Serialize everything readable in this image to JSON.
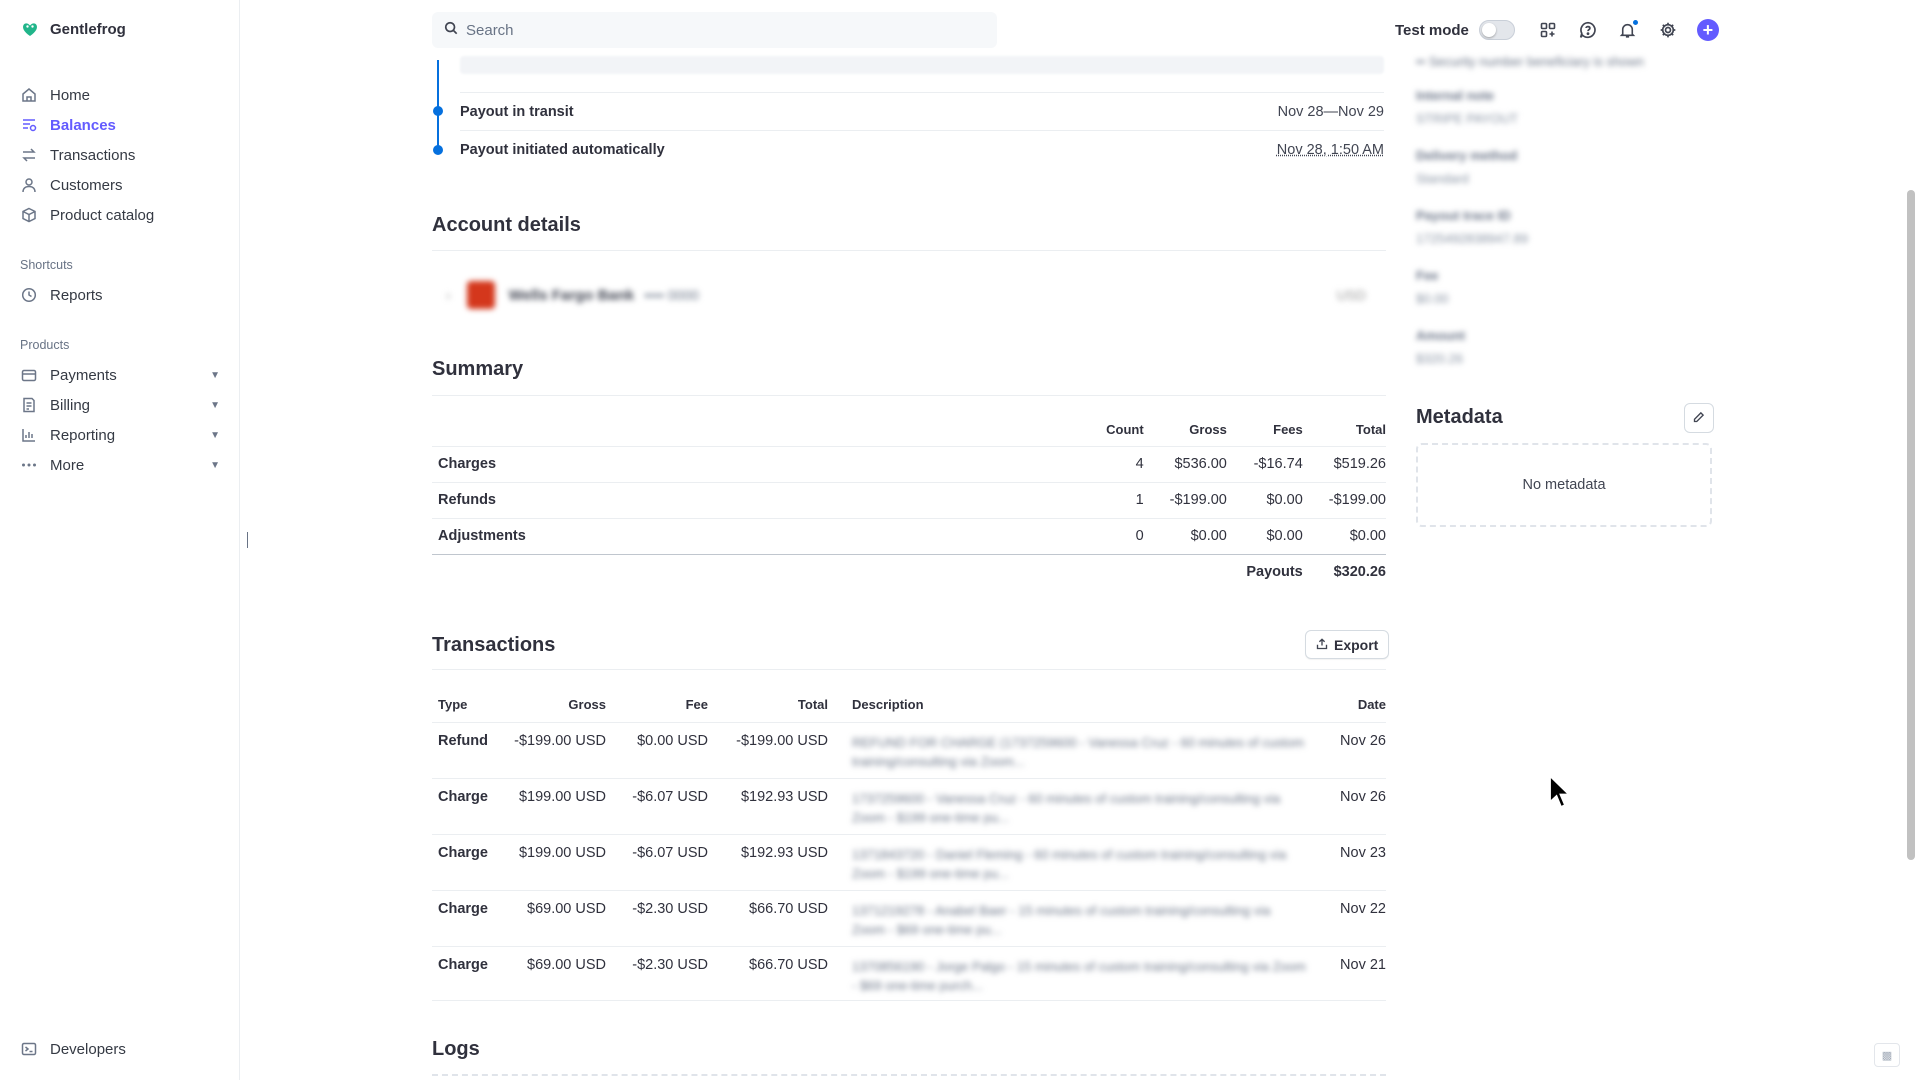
{
  "brand": {
    "name": "Gentlefrog",
    "icon": "gentlefrog-logo-icon",
    "accent": "#635bff"
  },
  "sidebar": {
    "items": [
      {
        "label": "Home",
        "icon": "home-icon"
      },
      {
        "label": "Balances",
        "icon": "balances-icon",
        "active": true
      },
      {
        "label": "Transactions",
        "icon": "transactions-icon"
      },
      {
        "label": "Customers",
        "icon": "customers-icon"
      },
      {
        "label": "Product catalog",
        "icon": "product-catalog-icon"
      }
    ],
    "shortcuts_label": "Shortcuts",
    "shortcuts": [
      {
        "label": "Reports",
        "icon": "clock-icon"
      }
    ],
    "products_label": "Products",
    "products": [
      {
        "label": "Payments",
        "icon": "payments-icon"
      },
      {
        "label": "Billing",
        "icon": "billing-icon"
      },
      {
        "label": "Reporting",
        "icon": "reporting-icon"
      },
      {
        "label": "More",
        "icon": "more-icon"
      }
    ],
    "developers": {
      "label": "Developers",
      "icon": "terminal-icon"
    }
  },
  "topbar": {
    "search_placeholder": "Search",
    "test_mode_label": "Test mode",
    "test_mode_on": false
  },
  "timeline": [
    {
      "label": "Payout in transit",
      "date": "Nov 28—Nov 29"
    },
    {
      "label": "Payout initiated automatically",
      "date": "Nov 28, 1:50 AM"
    }
  ],
  "account_details": {
    "title": "Account details",
    "bank_name": "Wells Fargo Bank",
    "last4": "•••• 0000",
    "currency": "USD"
  },
  "summary": {
    "title": "Summary",
    "headers": [
      "Count",
      "Gross",
      "Fees",
      "Total"
    ],
    "rows": [
      {
        "name": "Charges",
        "count": "4",
        "gross": "$536.00",
        "fees": "-$16.74",
        "total": "$519.26"
      },
      {
        "name": "Refunds",
        "count": "1",
        "gross": "-$199.00",
        "fees": "$0.00",
        "total": "-$199.00"
      },
      {
        "name": "Adjustments",
        "count": "0",
        "gross": "$0.00",
        "fees": "$0.00",
        "total": "$0.00"
      }
    ],
    "payouts_label": "Payouts",
    "payouts_total": "$320.26"
  },
  "transactions": {
    "title": "Transactions",
    "export_label": "Export",
    "headers": {
      "type": "Type",
      "gross": "Gross",
      "fee": "Fee",
      "total": "Total",
      "description": "Description",
      "date": "Date"
    },
    "rows": [
      {
        "type": "Refund",
        "gross": "-$199.00 USD",
        "fee": "$0.00 USD",
        "total": "-$199.00 USD",
        "description": "REFUND FOR CHARGE (1737259600 - Vanessa Cruz - 60 minutes of custom training/consulting via Zoom...",
        "date": "Nov 26"
      },
      {
        "type": "Charge",
        "gross": "$199.00 USD",
        "fee": "-$6.07 USD",
        "total": "$192.93 USD",
        "description": "1737259600 - Vanessa Cruz - 60 minutes of custom training/consulting via Zoom - $199 one-time pu...",
        "date": "Nov 26"
      },
      {
        "type": "Charge",
        "gross": "$199.00 USD",
        "fee": "-$6.07 USD",
        "total": "$192.93 USD",
        "description": "1371843720 - Daniel Fleming - 60 minutes of custom training/consulting via Zoom - $199 one-time pu...",
        "date": "Nov 23"
      },
      {
        "type": "Charge",
        "gross": "$69.00 USD",
        "fee": "-$2.30 USD",
        "total": "$66.70 USD",
        "description": "1371219278 - Anabel Baer - 15 minutes of custom training/consulting via Zoom - $69 one-time pu...",
        "date": "Nov 22"
      },
      {
        "type": "Charge",
        "gross": "$69.00 USD",
        "fee": "-$2.30 USD",
        "total": "$66.70 USD",
        "description": "1370856190 - Jorge Palgo - 15 minutes of custom training/consulting via Zoom - $69 one-time purch...",
        "date": "Nov 21"
      }
    ]
  },
  "logs": {
    "title": "Logs"
  },
  "details_panel": {
    "top_note": "•• Security number beneficiary is shown",
    "fields": [
      {
        "key": "Internal note",
        "value": "STRIPE PAYOUT"
      },
      {
        "key": "Delivery method",
        "value": "Standard"
      },
      {
        "key": "Payout trace ID",
        "value": "1725492838947.89"
      },
      {
        "key": "Fee",
        "value": "$0.00"
      },
      {
        "key": "Amount",
        "value": "$320.26"
      }
    ]
  },
  "metadata": {
    "title": "Metadata",
    "empty_text": "No metadata"
  }
}
